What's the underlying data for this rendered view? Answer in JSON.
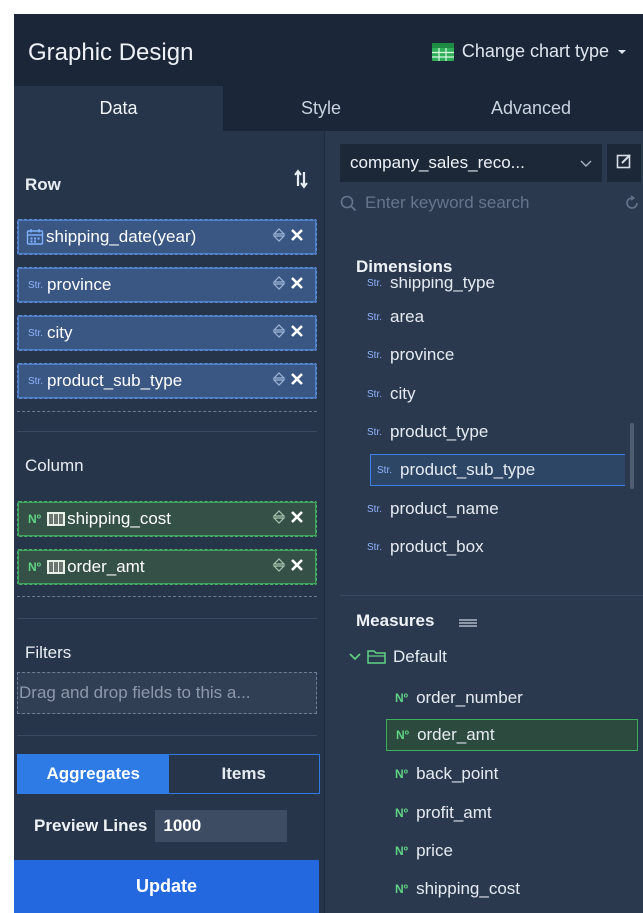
{
  "header": {
    "title": "Graphic Design",
    "change_chart_type": "Change chart type",
    "table_icon": "table-icon"
  },
  "tabs": [
    "Data",
    "Style",
    "Advanced"
  ],
  "left": {
    "row": {
      "title": "Row",
      "fields": [
        {
          "icon": "calendar-icon",
          "label": "shipping_date(year)"
        },
        {
          "tag": "Str.",
          "label": "province"
        },
        {
          "tag": "Str.",
          "label": "city"
        },
        {
          "tag": "Str.",
          "label": "product_sub_type"
        }
      ]
    },
    "column": {
      "title": "Column",
      "fields": [
        {
          "tag": "Nº",
          "label": "shipping_cost"
        },
        {
          "tag": "Nº",
          "label": "order_amt"
        }
      ]
    },
    "filters": {
      "title": "Filters",
      "placeholder": "Drag and drop fields to this a..."
    },
    "mode_buttons": {
      "aggregates": "Aggregates",
      "items": "Items"
    },
    "preview": {
      "label": "Preview Lines",
      "value": "1000"
    },
    "update": "Update"
  },
  "right": {
    "dataset": "company_sales_reco...",
    "search_placeholder": "Enter keyword search",
    "dimensions": {
      "title": "Dimensions",
      "tag": "Str.",
      "items": [
        "shipping_type",
        "area",
        "province",
        "city",
        "product_type",
        "product_sub_type",
        "product_name",
        "product_box"
      ],
      "selected": "product_sub_type"
    },
    "measures": {
      "title": "Measures",
      "folder": "Default",
      "tag": "Nº",
      "items": [
        "order_number",
        "order_amt",
        "back_point",
        "profit_amt",
        "price",
        "shipping_cost"
      ],
      "selected": "order_amt"
    }
  },
  "colors": {
    "accent_blue": "#2e7be6",
    "dimension_blue": "#3a5784",
    "measure_green": "#355147",
    "update_button": "#2468e0"
  }
}
